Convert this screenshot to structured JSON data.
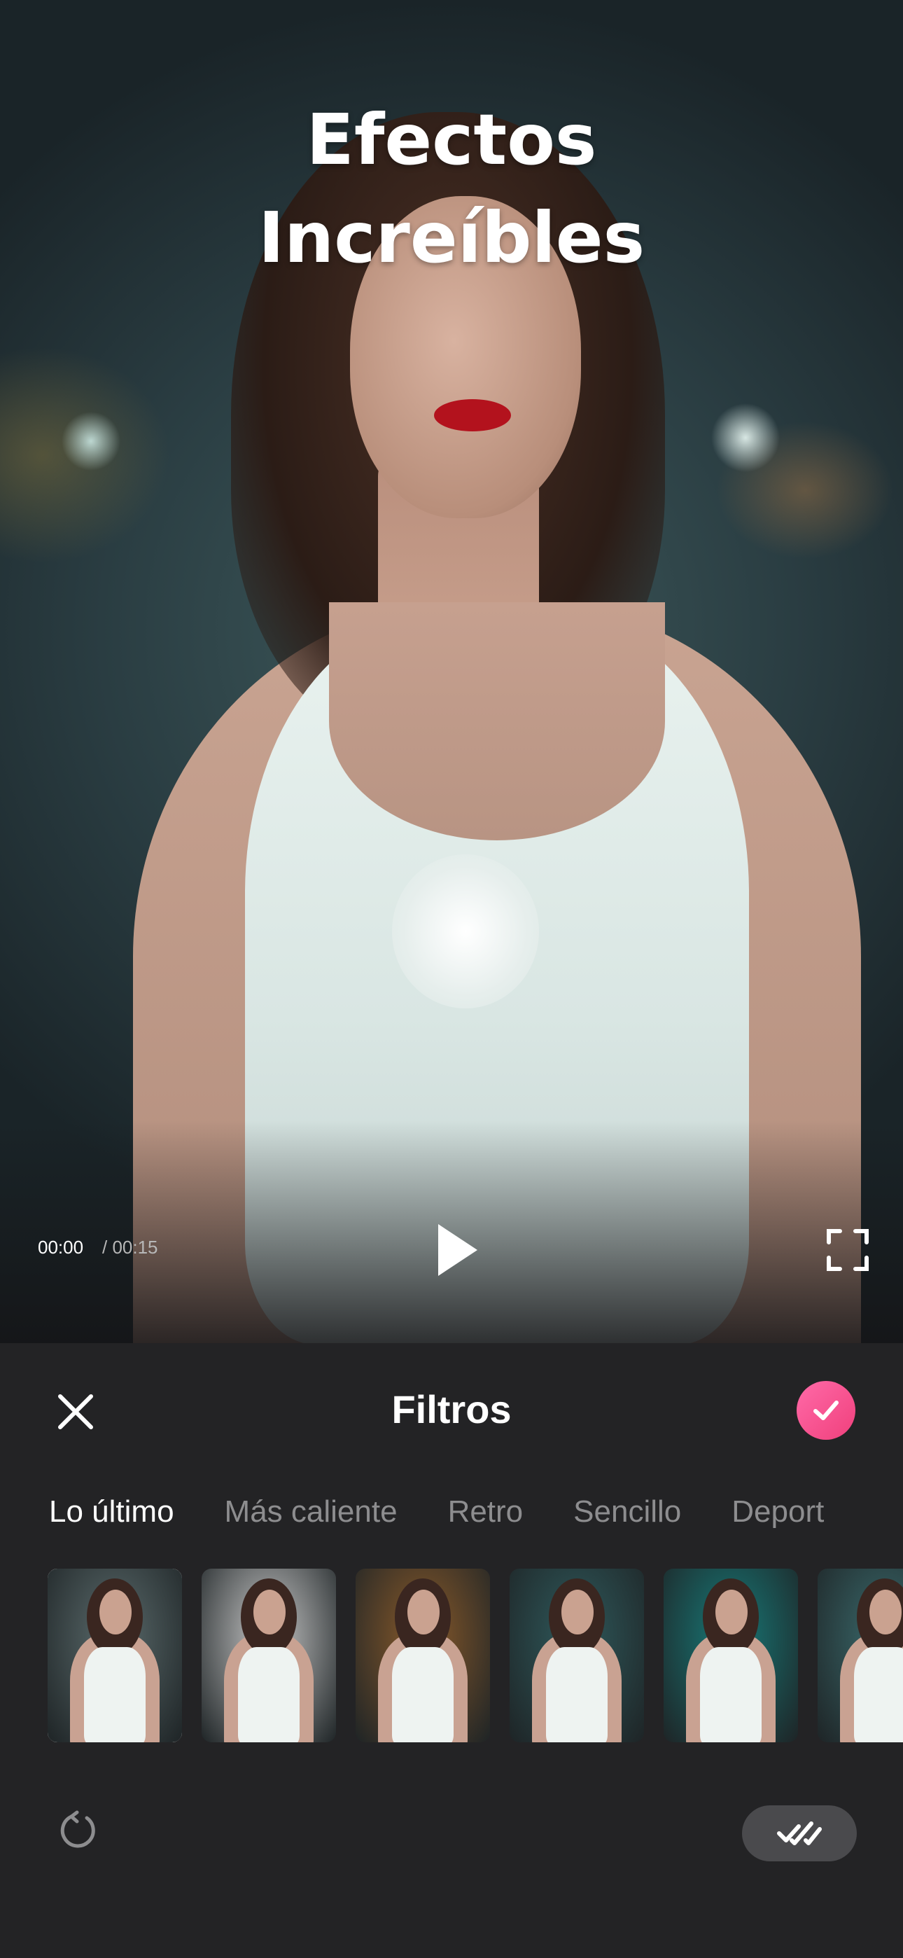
{
  "preview": {
    "headline_line1": "Efectos",
    "headline_line2": "Increíbles",
    "time_current": "00:00",
    "time_total": "/ 00:15"
  },
  "panel": {
    "title": "Filtros",
    "tabs": [
      {
        "label": "Lo último",
        "active": true
      },
      {
        "label": "Más caliente",
        "active": false
      },
      {
        "label": "Retro",
        "active": false
      },
      {
        "label": "Sencillo",
        "active": false
      },
      {
        "label": "Deport",
        "active": false
      }
    ],
    "filters": [
      {
        "tint": "#5b6b6c",
        "selected": true
      },
      {
        "tint": "#c8c8c8",
        "selected": false
      },
      {
        "tint": "#8a5a2a",
        "selected": false
      },
      {
        "tint": "#2f5a5c",
        "selected": false
      },
      {
        "tint": "#177a78",
        "selected": false
      },
      {
        "tint": "#3a6a6c",
        "selected": false
      }
    ]
  },
  "colors": {
    "panel_bg": "#232325",
    "accent_pink": "#f0407c",
    "inactive_tab": "#8d8d8f"
  },
  "icons": {
    "play": "play-icon",
    "fullscreen": "fullscreen-icon",
    "close": "close-icon",
    "confirm": "check-icon",
    "reset": "reset-icon",
    "apply_all": "double-check-icon"
  }
}
